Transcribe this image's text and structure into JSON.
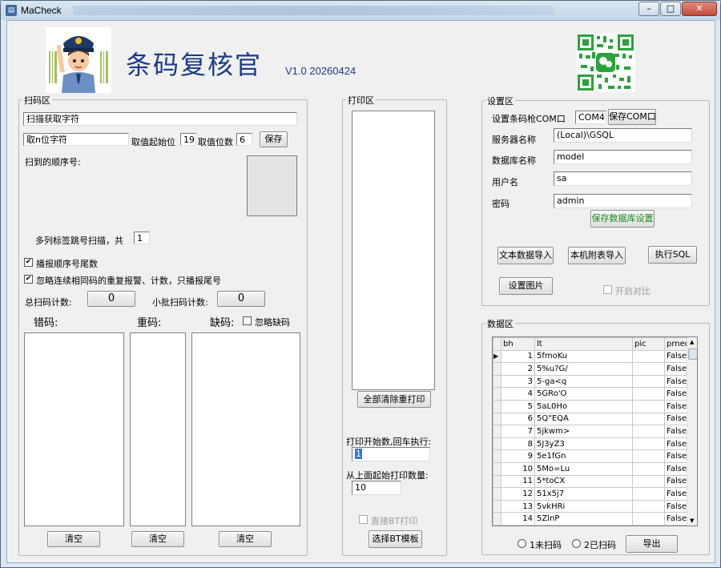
{
  "window": {
    "title": "MaCheck"
  },
  "header": {
    "app_title": "条码复核官",
    "version": "V1.0 20260424"
  },
  "scan": {
    "legend": "扫码区",
    "input_value": "扫描获取字符",
    "take_value": "取n位字符",
    "start_label": "取值起始位",
    "start_value": "19",
    "digits_label": "取值位数",
    "digits_value": "6",
    "save_button": "保存",
    "seq_label": "扫到的顺序号:",
    "multi_label": "多列标签跳号扫描，共",
    "multi_value": "1",
    "chk_tail_label": "播报顺序号尾数",
    "chk_ignore_label": "忽略连续相同码的重复报警、计数，只播报尾号",
    "total_label": "总扫码计数:",
    "total_value": "0",
    "batch_label": "小批扫码计数:",
    "batch_value": "0",
    "wrong_label": "错码:",
    "dup_label": "重码:",
    "missing_label": "缺码:",
    "ignore_missing_label": "忽略缺码",
    "clear1": "清空",
    "clear2": "清空",
    "clear3": "清空"
  },
  "print": {
    "legend": "打印区",
    "clear_reprint_button": "全部清除重打印",
    "start_label": "打印开始数,回车执行:",
    "start_value": "1",
    "count_label": "从上面起始打印数量:",
    "count_value": "10",
    "direct_bt_label": "直接BT打印",
    "select_template_button": "选择BT模板"
  },
  "settings": {
    "legend": "设置区",
    "com_label": "设置条码枪COM口",
    "com_value": "COM4",
    "save_com_button": "保存COM口",
    "server_label": "服务器名称",
    "server_value": "(Local)\\GSQL",
    "db_label": "数据库名称",
    "db_value": "model",
    "user_label": "用户名",
    "user_value": "sa",
    "pwd_label": "密码",
    "pwd_value": "admin",
    "save_db_button": "保存数据库设置",
    "import_text_button": "文本数据导入",
    "import_local_button": "本机附表导入",
    "exec_sql_button": "执行SQL",
    "set_image_button": "设置图片",
    "compare_label": "开启对比"
  },
  "data": {
    "legend": "数据区",
    "columns": [
      "bh",
      "lt",
      "pic",
      "prned"
    ],
    "rows": [
      [
        "1",
        "5fmoKu",
        "",
        "False"
      ],
      [
        "2",
        "5%u?G/",
        "",
        "False"
      ],
      [
        "3",
        "5-ga<q",
        "",
        "False"
      ],
      [
        "4",
        "5GRo'O",
        "",
        "False"
      ],
      [
        "5",
        "5aL0Ho",
        "",
        "False"
      ],
      [
        "6",
        "5Q\"EQA",
        "",
        "False"
      ],
      [
        "7",
        "5jkwm>",
        "",
        "False"
      ],
      [
        "8",
        "5J3yZ3",
        "",
        "False"
      ],
      [
        "9",
        "5e1fGn",
        "",
        "False"
      ],
      [
        "10",
        "5Mo=Lu",
        "",
        "False"
      ],
      [
        "11",
        "5*toCX",
        "",
        "False"
      ],
      [
        "12",
        "51x5j7",
        "",
        "False"
      ],
      [
        "13",
        "5vkHRi",
        "",
        "False"
      ],
      [
        "14",
        "5ZlnP",
        "",
        "False"
      ]
    ],
    "radio1_label": "1未扫码",
    "radio2_label": "2已扫码",
    "export_button": "导出"
  }
}
